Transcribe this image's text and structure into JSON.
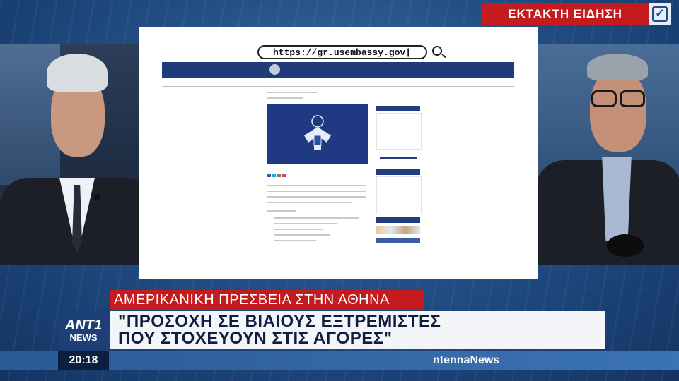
{
  "breaking_badge": {
    "label": "ΕΚΤΑΚΤΗ ΕΙΔΗΣΗ",
    "icon": "checkbox-icon"
  },
  "website": {
    "url": "https://gr.usembassy.gov|"
  },
  "lower_third": {
    "topic": "ΑΜΕΡΙΚΑΝΙΚΗ ΠΡΕΣΒΕΙΑ ΣΤΗΝ ΑΘΗΝΑ",
    "headline_line1": "\"ΠΡΟΣΟΧΗ ΣΕ ΒΙΑΙΟΥΣ ΕΞΤΡΕΜΙΣΤΕΣ",
    "headline_line2": "ΠΟΥ ΣΤΟΧΕΥΟΥΝ ΣΤΙΣ ΑΓΟΡΕΣ\""
  },
  "channel_logo": {
    "line1": "ANT1",
    "line2": "NEWS"
  },
  "clock": "20:18",
  "brand": "ntennaNews",
  "colors": {
    "accent_red": "#c41b1f",
    "navy": "#1d3f78",
    "bar_blue": "#3b73b4"
  }
}
